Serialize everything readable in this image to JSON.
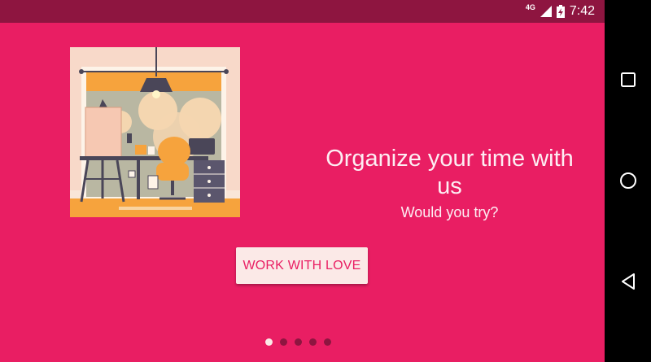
{
  "status_bar": {
    "network_label": "4G",
    "time": "7:42",
    "icons": [
      "signal-icon",
      "battery-icon"
    ]
  },
  "onboarding": {
    "title": "Organize your time with us",
    "subtitle": "Would you try?",
    "button_label": "WORK WITH LOVE",
    "page_count": 5,
    "active_page": 1,
    "illustration_icon": "workspace-illustration"
  },
  "nav_bar": {
    "icons": [
      "recents-icon",
      "home-icon",
      "back-icon"
    ]
  },
  "colors": {
    "primary": "#e91e63",
    "status_bar": "#8e1540",
    "button_bg": "#fbe9e7",
    "nav_bar": "#000000"
  }
}
